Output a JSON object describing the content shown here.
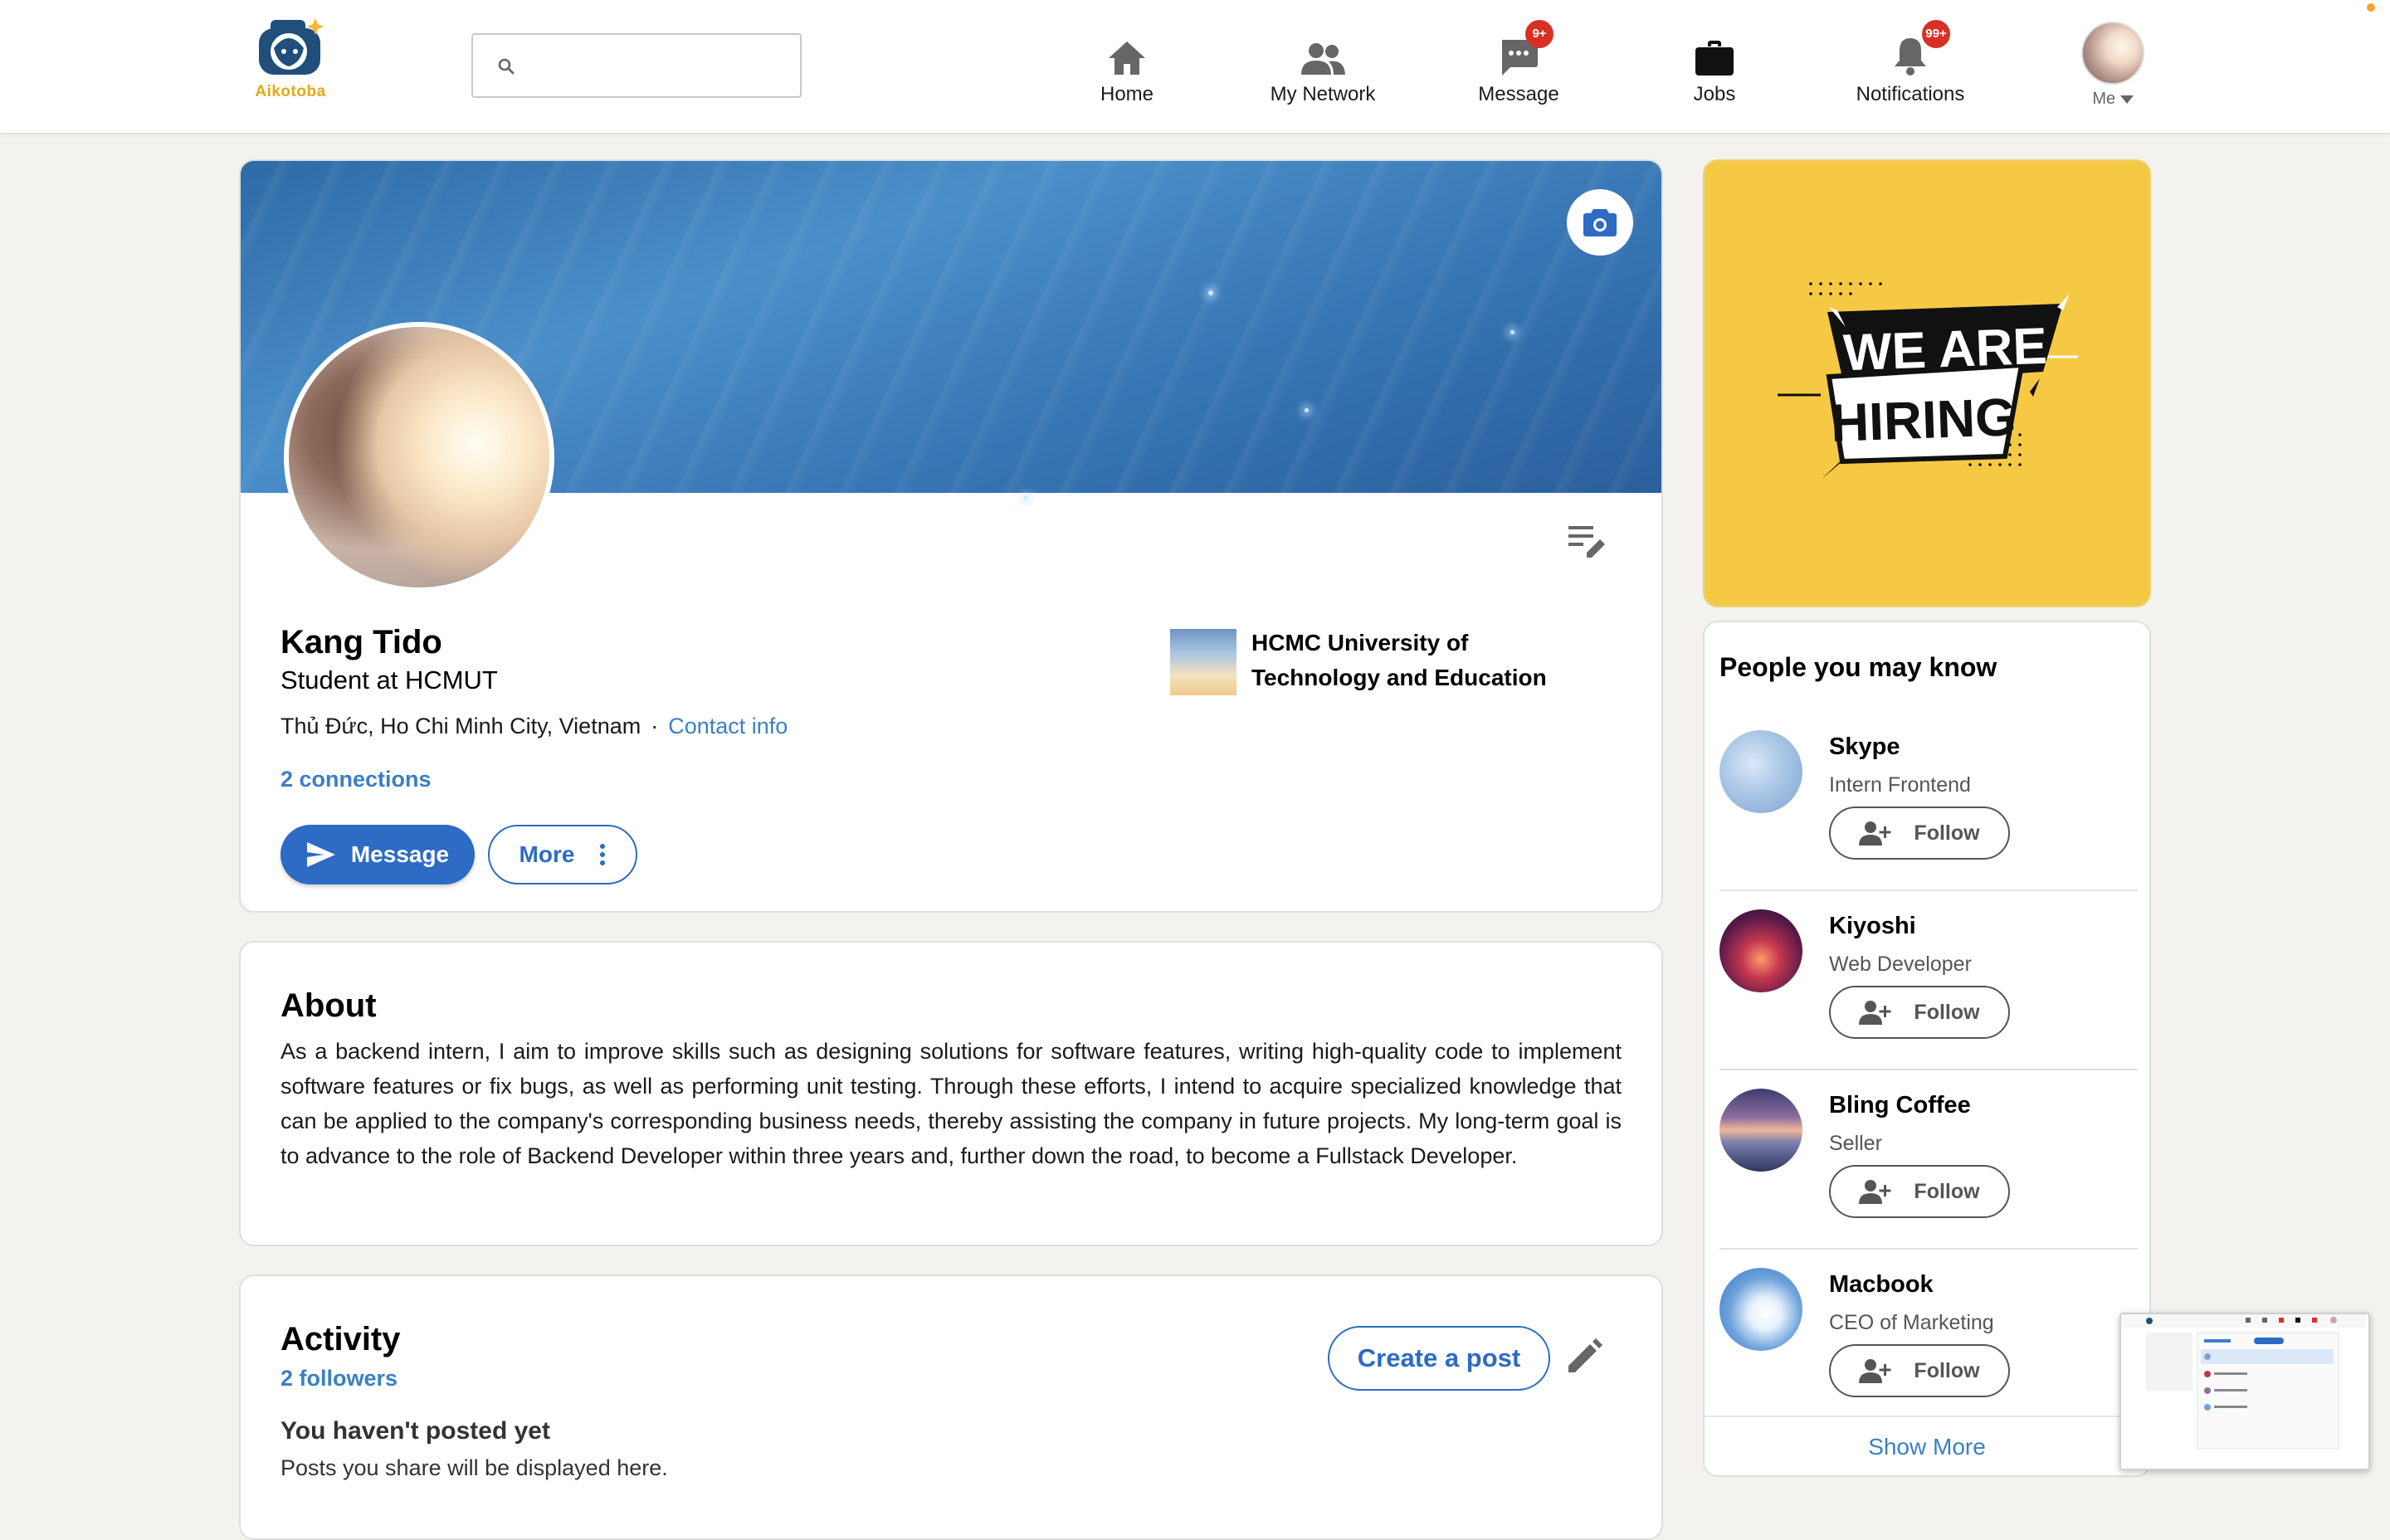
{
  "brand": {
    "name": "Aikotoba",
    "accent": "#e6a817"
  },
  "search": {
    "placeholder": "",
    "value": ""
  },
  "nav": {
    "items": [
      {
        "label": "Home",
        "icon": "home-icon",
        "badge": ""
      },
      {
        "label": "My Network",
        "icon": "network-icon",
        "badge": ""
      },
      {
        "label": "Message",
        "icon": "message-icon",
        "badge": "9+"
      },
      {
        "label": "Jobs",
        "icon": "briefcase-icon",
        "badge": ""
      },
      {
        "label": "Notifications",
        "icon": "bell-icon",
        "badge": "99+"
      }
    ],
    "me_label": "Me"
  },
  "profile": {
    "name": "Kang Tido",
    "headline": "Student at HCMUT",
    "location": "Thủ Đức, Ho Chi Minh City, Vietnam",
    "separator": "·",
    "contact_label": "Contact info",
    "connections": "2 connections",
    "message_button": "Message",
    "more_button": "More",
    "school": "HCMC University of Technology and Education"
  },
  "about": {
    "title": "About",
    "text": "As a backend intern, I aim to improve skills such as designing solutions for software features, writing high-quality code to implement software features or fix bugs, as well as performing unit testing. Through these efforts, I intend to acquire specialized knowledge that can be applied to the company's corresponding business needs, thereby assisting the company in future projects. My long-term goal is to advance to the role of Backend Developer within three years and, further down the road, to become a Fullstack Developer."
  },
  "activity": {
    "title": "Activity",
    "followers": "2 followers",
    "create_post": "Create a post",
    "empty_title": "You haven't posted yet",
    "empty_sub": "Posts you share will be displayed here."
  },
  "ad": {
    "line1": "WE ARE",
    "line2": "HIRING",
    "bg_color": "#f6c945"
  },
  "people": {
    "title": "People you may know",
    "follow_label": "Follow",
    "items": [
      {
        "name": "Skype",
        "role": "Intern Frontend"
      },
      {
        "name": "Kiyoshi",
        "role": "Web Developer"
      },
      {
        "name": "Bling Coffee",
        "role": "Seller"
      },
      {
        "name": "Macbook",
        "role": "CEO of Marketing"
      }
    ],
    "show_more": "Show More"
  },
  "colors": {
    "link": "#3b7fc4",
    "primary_button": "#2d6bc4",
    "badge": "#d93025",
    "page_bg": "#f3f2ef"
  }
}
